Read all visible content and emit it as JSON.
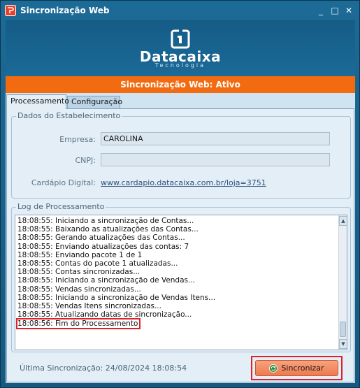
{
  "window": {
    "title": "Sincronização Web",
    "controls": {
      "minimize": "_",
      "maximize": "□",
      "close": "✕"
    }
  },
  "banner": {
    "brand": "Datacaixa",
    "tagline": "Tecnologia",
    "brand_color": "#155c86"
  },
  "status": {
    "text": "Sincronização Web: Ativo",
    "color": "#f26b10"
  },
  "tabs": [
    {
      "label": "Processamento",
      "active": true
    },
    {
      "label": "Configuração",
      "active": false
    }
  ],
  "establishment": {
    "group_title": "Dados do Estabelecimento",
    "empresa_label": "Empresa:",
    "empresa_value": "CAROLINA",
    "cnpj_label": "CNPJ:",
    "cnpj_value": "",
    "cardapio_label": "Cardápio Digital:",
    "cardapio_link": "www.cardapio.datacaixa.com.br/loja=3751"
  },
  "log": {
    "group_title": "Log de Processamento",
    "lines": [
      "18:08:55: Iniciando a sincronização de Contas...",
      "18:08:55: Baixando as atualizações das Contas...",
      "18:08:55: Gerando atualizações das Contas...",
      "18:08:55: Enviando atualizações das contas: 7",
      "18:08:55: Enviando pacote 1 de 1",
      "18:08:55: Contas do pacote 1 atualizadas...",
      "18:08:55: Contas sincronizadas...",
      "18:08:55: Iniciando a sincronização de Vendas...",
      "18:08:55: Vendas sincronizadas...",
      "18:08:55: Iniciando a sincronização de Vendas Itens...",
      "18:08:55: Vendas Itens sincronizadas...",
      "18:08:55: Atualizando datas de sincronização...",
      "18:08:56: Fim do Processamento"
    ],
    "highlighted_index": 12,
    "highlight_color": "#e0202a"
  },
  "footer": {
    "last_sync": "Última Sincronização: 24/08/2024 18:08:54",
    "sync_button": "Sincronizar",
    "sync_button_color": "#ee7a4e"
  }
}
